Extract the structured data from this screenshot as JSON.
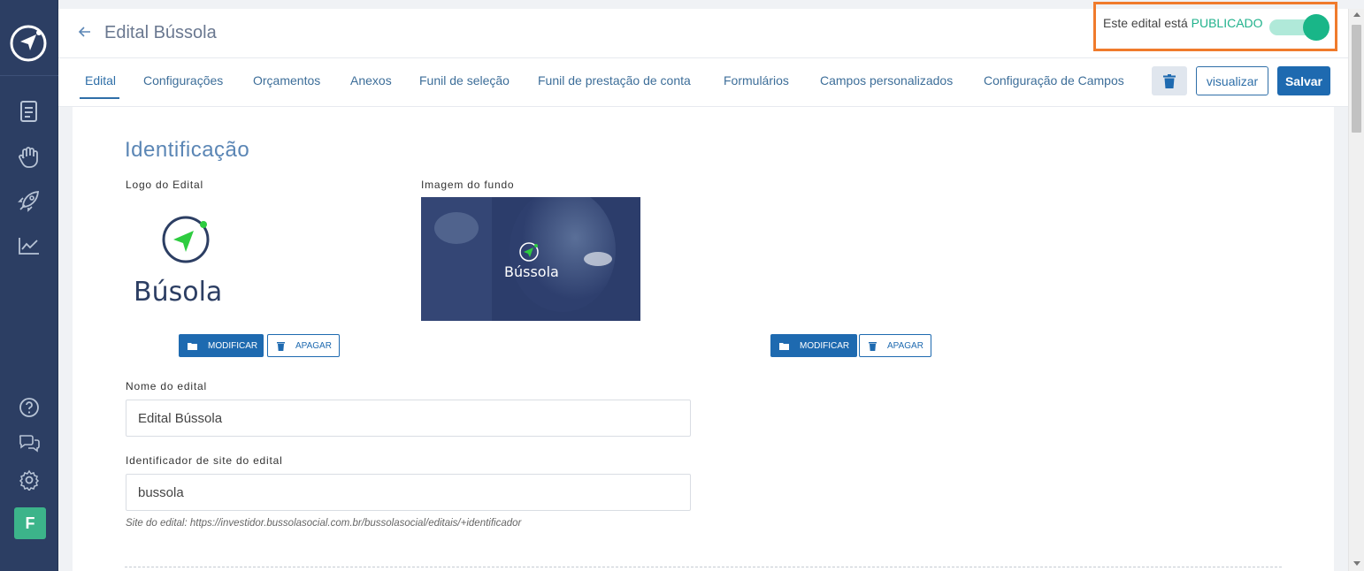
{
  "header": {
    "title": "Edital Bússola",
    "status_prefix": "Este edital está",
    "status_value": "PUBLICADO",
    "published": true
  },
  "tabs": [
    {
      "label": "Edital",
      "active": true
    },
    {
      "label": "Configurações",
      "active": false
    },
    {
      "label": "Orçamentos",
      "active": false
    },
    {
      "label": "Anexos",
      "active": false
    },
    {
      "label": "Funil de seleção",
      "active": false
    },
    {
      "label": "Funil de prestação de conta",
      "active": false
    },
    {
      "label": "Formulários",
      "active": false
    },
    {
      "label": "Campos personalizados",
      "active": false
    },
    {
      "label": "Configuração de Campos",
      "active": false
    }
  ],
  "toolbar": {
    "visualizar_label": "visualizar",
    "salvar_label": "Salvar"
  },
  "sidebar": {
    "icons": [
      "document-icon",
      "hand-heart-icon",
      "rocket-icon",
      "chart-trend-icon",
      "help-icon",
      "chat-icon",
      "gear-icon"
    ],
    "avatar_initial": "F"
  },
  "main": {
    "section_title": "Identificação",
    "logo_label": "Logo do Edital",
    "logo_text": "Búsola",
    "background_label": "Imagem do fundo",
    "background_text": "Bússola",
    "modify_label": "MODIFICAR",
    "delete_label": "APAGAR",
    "name_label": "Nome do edital",
    "name_value": "Edital Bússola",
    "site_id_label": "Identificador de site do edital",
    "site_id_value": "bussola",
    "site_hint": "Site do edital: https://investidor.bussolasocial.com.br/bussolasocial/editais/+identificador"
  },
  "colors": {
    "sidebar": "#2c3e63",
    "primary": "#1e6ab0",
    "accent_green": "#19b688",
    "highlight": "#f07b2c"
  }
}
